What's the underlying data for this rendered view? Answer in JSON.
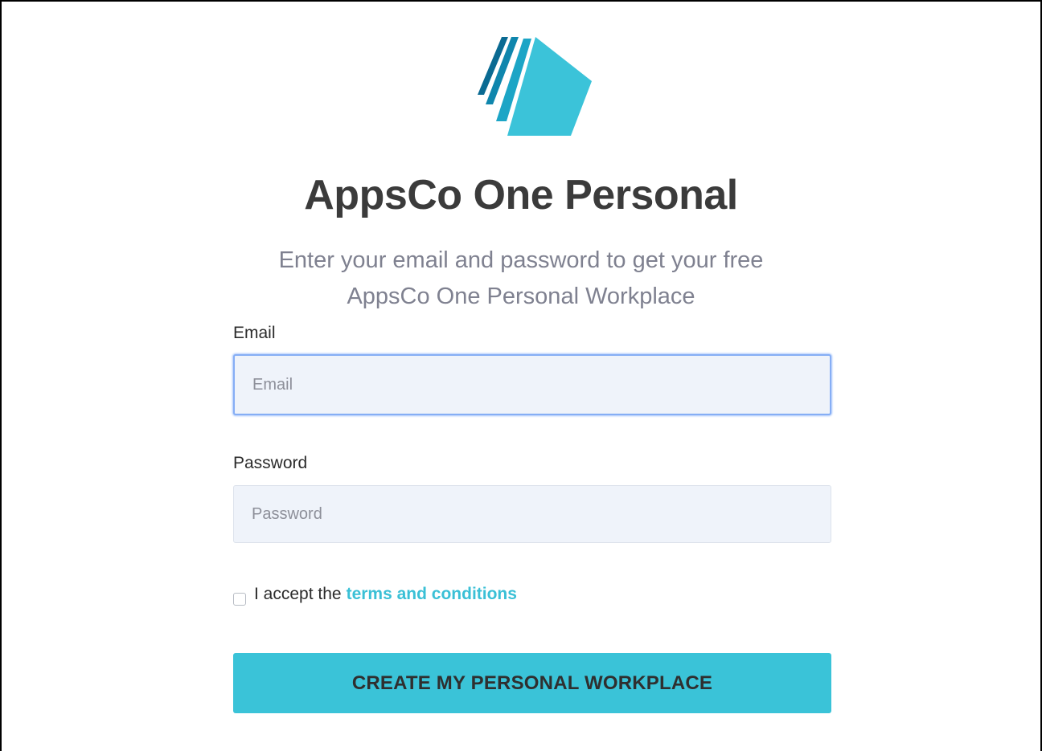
{
  "brand": {
    "logo_icon": "appsco-logo-icon",
    "colors": {
      "stripe_dark": "#0a6a92",
      "stripe_mid": "#0f86ad",
      "stripe_light": "#1ca5c6",
      "panel": "#3bc3d9"
    }
  },
  "header": {
    "title": "AppsCo One Personal",
    "subtitle_line1": "Enter your email and password to get your free",
    "subtitle_line2": "AppsCo One Personal Workplace"
  },
  "form": {
    "email": {
      "label": "Email",
      "placeholder": "Email",
      "value": ""
    },
    "password": {
      "label": "Password",
      "placeholder": "Password",
      "value": ""
    },
    "terms": {
      "checked": false,
      "text": "I accept the",
      "link_text": "terms and conditions"
    },
    "submit_label": "CREATE MY PERSONAL WORKPLACE"
  },
  "theme": {
    "accent": "#3ac3d8",
    "link": "#3ac0d6",
    "input_bg": "#eff3fa",
    "focus_ring": "#86aef5",
    "title_color": "#3b3b3b",
    "subtitle_color": "#7f8190"
  }
}
